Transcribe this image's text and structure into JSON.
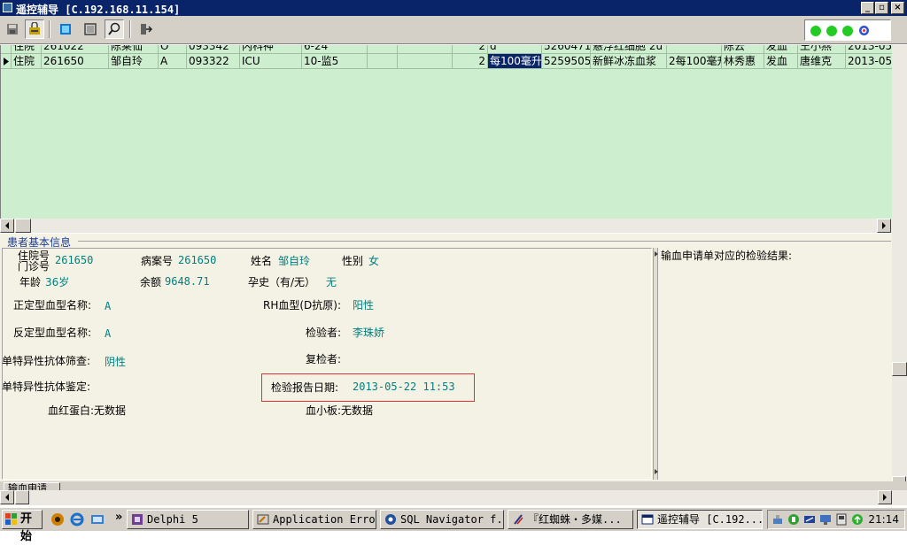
{
  "window": {
    "title": "遥控辅导 [C.192.168.11.154]",
    "controls": {
      "minimize": "_",
      "restore": "▫",
      "close": "×"
    }
  },
  "toolbar": {
    "buttons": [
      "save-icon",
      "lock-icon",
      "fullscreen-icon",
      "fit-window-icon",
      "zoom-icon",
      "exit-icon"
    ],
    "status_dots": [
      "#22cc22",
      "#22cc22",
      "#22cc22"
    ]
  },
  "grid": {
    "rows": [
      {
        "cells": [
          "住院",
          "261022",
          "陈莱仙",
          "O",
          "093342",
          "内科神",
          "6-24",
          "",
          "",
          "2",
          "d",
          "5260471",
          "悬浮红细胞 2u",
          "",
          "陈云",
          "发血",
          "王小燕",
          "2013-05"
        ]
      },
      {
        "cells": [
          "住院",
          "261650",
          "邹自玲",
          "A",
          "093322",
          "ICU",
          "10-监5",
          "",
          "",
          "2",
          "每100毫升",
          "5259505",
          "新鲜冰冻血浆",
          "2每100毫升",
          "林秀惠",
          "发血",
          "唐维克",
          "2013-05"
        ]
      }
    ]
  },
  "info": {
    "section_title": "患者基本信息",
    "inpatient_no_label": "住院号",
    "outpatient_no_label": "门诊号",
    "inpatient_no": "261650",
    "case_no_label": "病案号",
    "case_no": "261650",
    "name_label": "姓名",
    "name": "邹自玲",
    "sex_label": "性别",
    "sex": "女",
    "age_label": "年龄",
    "age": "36岁",
    "balance_label": "余额",
    "balance": "9648.71",
    "pregnancy_label": "孕史（有/无）",
    "pregnancy": "无",
    "forward_blood_label": "正定型血型名称:",
    "forward_blood": "A",
    "rh_label": "RH血型(D抗原):",
    "rh": "阳性",
    "reverse_blood_label": "反定型血型名称:",
    "reverse_blood": "A",
    "inspector_label": "检验者:",
    "inspector": "李珠娇",
    "antibody_screen_label": "单特异性抗体筛查:",
    "antibody_screen": "阴性",
    "reviewer_label": "复检者:",
    "reviewer": "",
    "antibody_ident_label": "单特异性抗体鉴定:",
    "report_date_label": "检验报告日期:",
    "report_date": "2013-05-22 11:53",
    "hemoglobin": "血红蛋白:无数据",
    "platelet": "血小板:无数据",
    "right_title": "输血申请单对应的检验结果:"
  },
  "tabs": {
    "transfusion": "输血申请"
  },
  "taskbar": {
    "start": "开始",
    "overflow": "»",
    "tasks": [
      "Delphi 5",
      "Application Error",
      "SQL Navigator f...",
      "『红蜘蛛・多媒...",
      "遥控辅导 [C.192..."
    ],
    "clock": "21:14"
  }
}
